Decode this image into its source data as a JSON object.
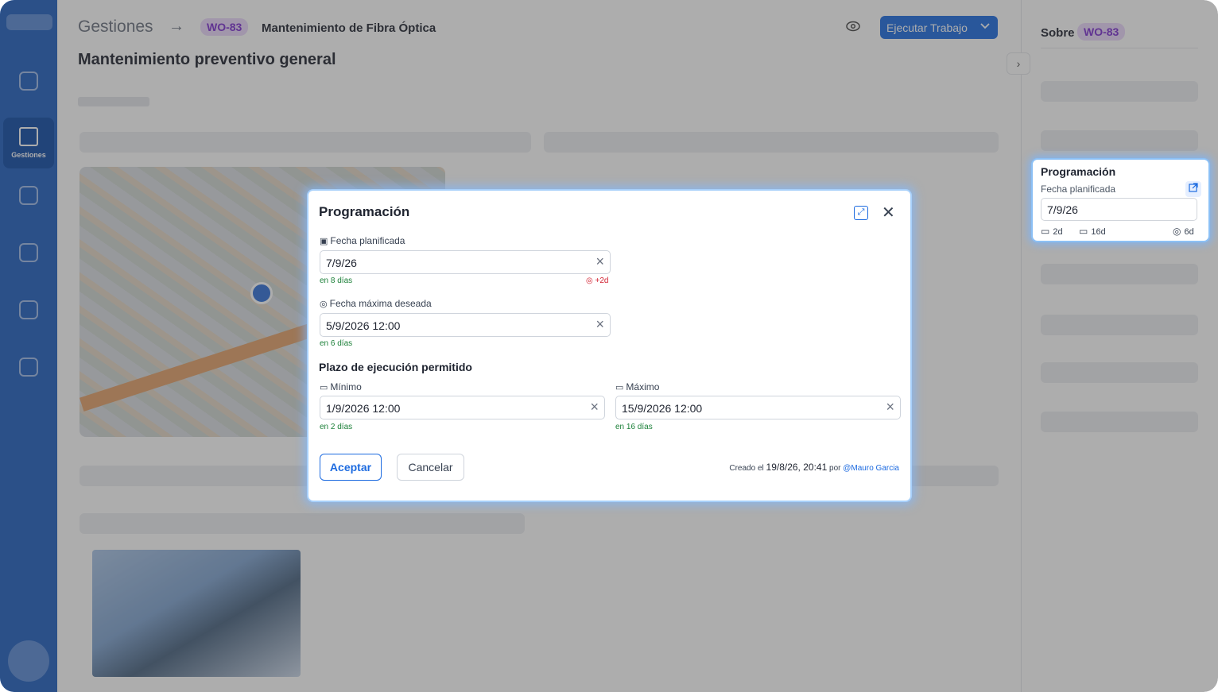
{
  "app": {
    "brand_label": "",
    "nav": [
      {
        "label": "",
        "active": false
      },
      {
        "label": "Gestiones",
        "active": true
      },
      {
        "label": "",
        "active": false
      },
      {
        "label": "",
        "active": false
      },
      {
        "label": "",
        "active": false
      },
      {
        "label": "",
        "active": false
      }
    ]
  },
  "header": {
    "breadcrumb_root": "Gestiones",
    "breadcrumb_id": "WO-83",
    "breadcrumb_title": "Mantenimiento de Fibra Óptica",
    "execute_label": "Ejecutar Trabajo",
    "page_title": "Mantenimiento preventivo general"
  },
  "right_panel": {
    "sobre_label": "Sobre",
    "sobre_id": "WO-83",
    "programacion": {
      "title": "Programación",
      "field_label": "Fecha planificada",
      "value": "7/9/26",
      "meta_min": "2d",
      "meta_max": "16d",
      "meta_target": "6d"
    }
  },
  "modal": {
    "title": "Programación",
    "planned": {
      "label": "Fecha planificada",
      "value": "7/9/26",
      "hint": "en 8 días",
      "warning": "+2d"
    },
    "desired_max": {
      "label": "Fecha máxima deseada",
      "value": "5/9/2026 12:00",
      "hint": "en 6 días"
    },
    "window_section": "Plazo de ejecución permitido",
    "minimum": {
      "label": "Mínimo",
      "value": "1/9/2026 12:00",
      "hint": "en 2 días"
    },
    "maximum": {
      "label": "Máximo",
      "value": "15/9/2026 12:00",
      "hint": "en 16 días"
    },
    "accept_label": "Aceptar",
    "cancel_label": "Cancelar",
    "created_prefix": "Creado el",
    "created_date": "19/8/26, 20:41",
    "created_by_prefix": "por",
    "created_by": "@Mauro Garcia"
  },
  "colors": {
    "primary": "#1d6be0",
    "sidebar": "#1f5fbf",
    "badge_bg": "#ead7fb",
    "badge_text": "#7c2fd1",
    "success": "#1a7f37",
    "danger": "#d21f2f"
  },
  "icons": {
    "expand": "expand-icon",
    "close": "close-icon",
    "clear": "clear-icon",
    "calendar": "calendar-icon",
    "target": "target-icon",
    "eye": "eye-icon",
    "chevron": "chevron-down-icon"
  }
}
